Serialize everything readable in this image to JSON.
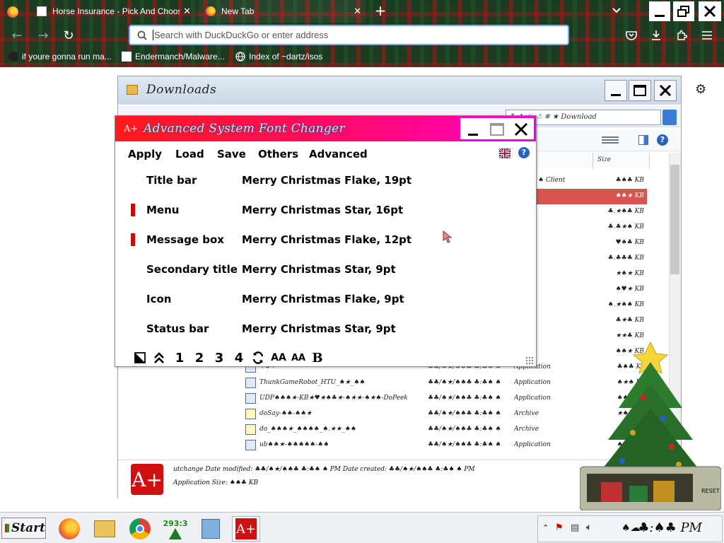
{
  "browser": {
    "tabs": [
      {
        "title": "Horse Insurance - Pick And Choos",
        "active": false
      },
      {
        "title": "New Tab",
        "active": true
      }
    ],
    "new_tab_label": "+",
    "address_placeholder": "Search with DuckDuckGo or enter address",
    "bookmarks": [
      {
        "label": "if youre gonna run ma..."
      },
      {
        "label": "Endermanch/Malware..."
      },
      {
        "label": "Index of ~dartz/isos"
      }
    ]
  },
  "explorer": {
    "title": "Downloads",
    "search_text": "⁂ ♠ ☼ ☃ ❄ ★ Download",
    "column_size": "Size",
    "selected_row_size": "♠♠★ KB",
    "rows": [
      {
        "name": "✶♠✶",
        "date": "♣♣/♠★/♠♠♣ ♣:♣♠ ♠",
        "type": "Application",
        "size": "♣♠♣ KB"
      },
      {
        "name": "ThunkGameRobot_HTU_♠★_♠♠",
        "date": "♣♣/♠★/♠♠♣ ♣:♣♠ ♠",
        "type": "Application",
        "size": "♠★♠ KB"
      },
      {
        "name": "UDP♠♠♠★-KB★♥★♠♣★-♠★★-♠★♠-DoPeek",
        "date": "♣♣/♠★/♠♠♣ ♣:♣♠ ♠",
        "type": "Application",
        "size": "♠♠♠ KB"
      },
      {
        "name": "doSay-♠♠-♠♠★",
        "date": "♣♣/♠★/♠♠♣ ♣:♣♠ ♠",
        "type": "Archive",
        "size": "★♠♠ KB"
      },
      {
        "name": "do_♠♠♠★_♠♠♠♠_♠.★★_♠♠",
        "date": "♣♣/♠★/♠♠♣ ♣:♣♠ ♠",
        "type": "Archive",
        "size": "♠♠♠ KB"
      },
      {
        "name": "ub♠♠★-♠♠♠♠♠-♠♠",
        "date": "♣♣/♠★/♠♠♣ ♣:♣♠ ♠",
        "type": "Application",
        "size": "♠♠♠ KB"
      }
    ],
    "side_rows": [
      {
        "c1": "♠ Client",
        "c2": "♣♠♣ KB"
      },
      {
        "c1": "",
        "c2": "♠♠★ KB"
      },
      {
        "c1": "",
        "c2": "♣.★♠♣ KB"
      },
      {
        "c1": "",
        "c2": "♣.♣★♠ KB"
      },
      {
        "c1": "",
        "c2": "♥♠♣ KB"
      },
      {
        "c1": "",
        "c2": "♣.♣♣♣ KB"
      },
      {
        "c1": "",
        "c2": "★♠★ KB"
      },
      {
        "c1": "",
        "c2": "♠♥★ KB"
      },
      {
        "c1": "",
        "c2": "♠.★♠♠ KB"
      },
      {
        "c1": "",
        "c2": "♣★♣ KB"
      },
      {
        "c1": "",
        "c2": "★★♣ KB"
      },
      {
        "c1": "",
        "c2": "♠♠★ KB"
      }
    ],
    "details": {
      "line1": "utchange   Date modified: ♣♣/♠★/♠♠♣ ♣:♣♠ ♠ PM    Date created: ♣♣/♠★/♠♠♣ ♣:♣♠ ♠ PM",
      "line2": "Application              Size: ♠♠♣ KB",
      "icon_text": "A+"
    }
  },
  "font_changer": {
    "title": "Advanced System Font Changer",
    "icon_text": "A+",
    "menu": [
      "Apply",
      "Load",
      "Save",
      "Others",
      "Advanced"
    ],
    "fonts": [
      {
        "label": "Title bar",
        "value": "Merry Christmas Flake, 19pt",
        "marked": false
      },
      {
        "label": "Menu",
        "value": "Merry Christmas Star, 16pt",
        "marked": true
      },
      {
        "label": "Message box",
        "value": "Merry Christmas Flake, 12pt",
        "marked": true
      },
      {
        "label": "Secondary title",
        "value": "Merry Christmas Star, 9pt",
        "marked": false
      },
      {
        "label": "Icon",
        "value": "Merry Christmas Flake, 9pt",
        "marked": false
      },
      {
        "label": "Status bar",
        "value": "Merry Christmas Star, 9pt",
        "marked": false
      }
    ],
    "toolbar": [
      "◪",
      "⇈",
      "1",
      "2",
      "3",
      "4",
      "⟳",
      "AA",
      "AA",
      "B"
    ]
  },
  "taskbar": {
    "start_label": "Start",
    "counter_label": "293:3",
    "clock": "♣:♠♣ PM",
    "tray_text": "♠☁♣",
    "reset_label": "RESET"
  },
  "colors": {
    "accent_red": "#d01010",
    "title_gradient_start": "#ff1a1a",
    "title_gradient_end": "#ff00c8",
    "url_focus": "#6ab0ff",
    "selection": "#d9534f"
  }
}
